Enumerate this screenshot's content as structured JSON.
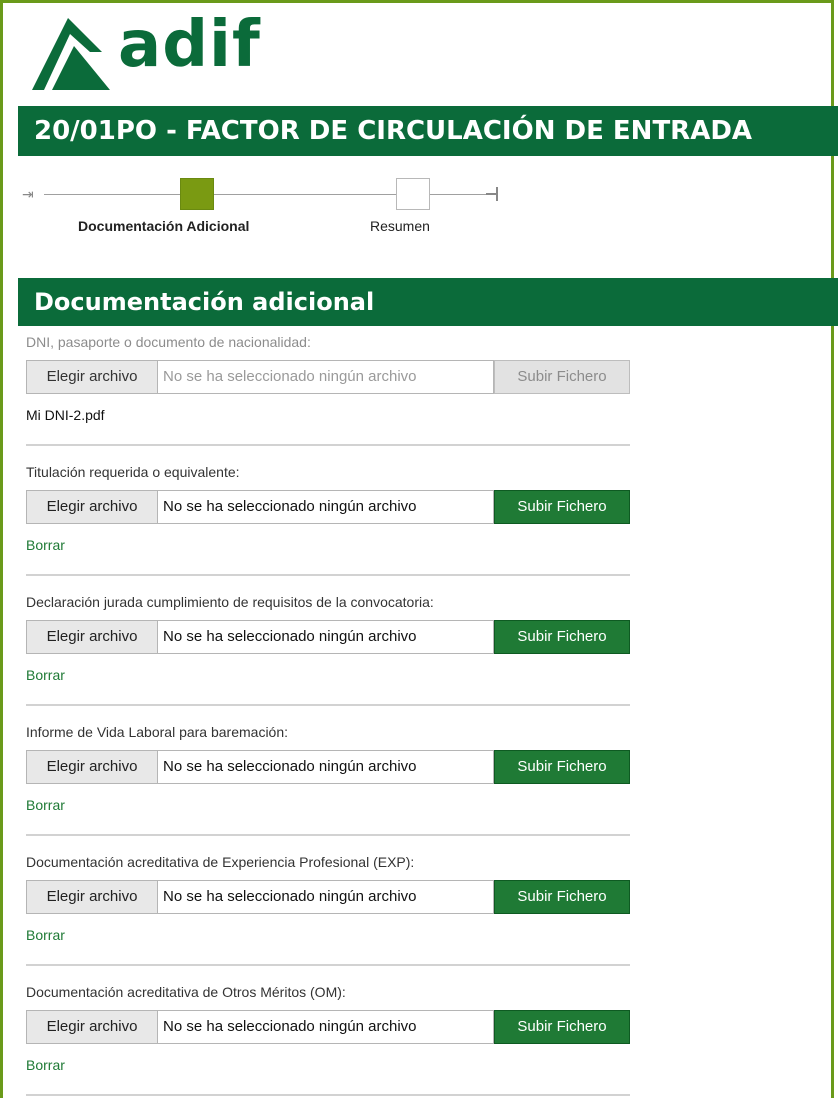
{
  "brand": {
    "logo_text": "adif",
    "brand_color": "#0b6b3a",
    "accent_color": "#7a9a12"
  },
  "header": {
    "title": "20/01PO - FACTOR DE CIRCULACIÓN DE ENTRADA"
  },
  "stepper": {
    "steps": [
      {
        "label": "Documentación Adicional",
        "state": "active"
      },
      {
        "label": "Resumen",
        "state": "inactive"
      }
    ]
  },
  "section": {
    "title": "Documentación adicional"
  },
  "fields": [
    {
      "label": "DNI, pasaporte o documento de nacionalidad:",
      "disabled": true,
      "choose_label": "Elegir archivo",
      "file_status": "No se ha seleccionado ningún archivo",
      "upload_label": "Subir Fichero",
      "uploaded_file": "Mi DNI-2.pdf"
    },
    {
      "label": "Titulación requerida o equivalente:",
      "choose_label": "Elegir archivo",
      "file_status": "No se ha seleccionado ningún archivo",
      "upload_label": "Subir Fichero",
      "delete_label": "Borrar"
    },
    {
      "label": "Declaración jurada cumplimiento de requisitos de la convocatoria:",
      "choose_label": "Elegir archivo",
      "file_status": "No se ha seleccionado ningún archivo",
      "upload_label": "Subir Fichero",
      "delete_label": "Borrar"
    },
    {
      "label": "Informe de Vida Laboral para baremación:",
      "choose_label": "Elegir archivo",
      "file_status": "No se ha seleccionado ningún archivo",
      "upload_label": "Subir Fichero",
      "delete_label": "Borrar"
    },
    {
      "label": "Documentación acreditativa de Experiencia Profesional (EXP):",
      "choose_label": "Elegir archivo",
      "file_status": "No se ha seleccionado ningún archivo",
      "upload_label": "Subir Fichero",
      "delete_label": "Borrar"
    },
    {
      "label": "Documentación acreditativa de Otros Méritos (OM):",
      "choose_label": "Elegir archivo",
      "file_status": "No se ha seleccionado ningún archivo",
      "upload_label": "Subir Fichero",
      "delete_label": "Borrar"
    }
  ]
}
